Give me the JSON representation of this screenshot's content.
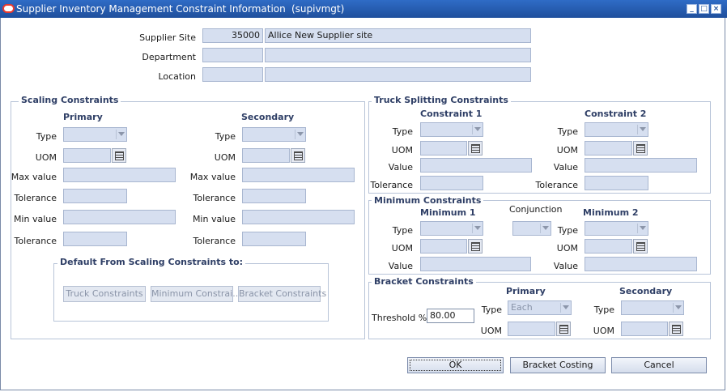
{
  "window": {
    "title": "Supplier Inventory Management Constraint Information",
    "form_code": "(supivmgt)"
  },
  "header": {
    "supplier_site_label": "Supplier Site",
    "supplier_site_id": "35000",
    "supplier_site_name": "Allice New Supplier site",
    "department_label": "Department",
    "location_label": "Location"
  },
  "scaling": {
    "title": "Scaling Constraints",
    "primary_header": "Primary",
    "secondary_header": "Secondary",
    "type_label": "Type",
    "uom_label": "UOM",
    "max_value_label": "Max value",
    "tolerance_label": "Tolerance",
    "min_value_label": "Min value",
    "default_title": "Default From Scaling Constraints to:",
    "truck_button": "Truck Constraints",
    "minimum_button": "Minimum Constrai...",
    "bracket_button": "Bracket Constraints"
  },
  "truck": {
    "title": "Truck Splitting Constraints",
    "c1_header": "Constraint 1",
    "c2_header": "Constraint 2",
    "type_label": "Type",
    "uom_label": "UOM",
    "value_label": "Value",
    "tolerance_label": "Tolerance"
  },
  "minimum": {
    "title": "Minimum Constraints",
    "m1_header": "Minimum 1",
    "conjunction_label": "Conjunction",
    "m2_header": "Minimum 2",
    "type_label": "Type",
    "uom_label": "UOM",
    "value_label": "Value"
  },
  "bracket": {
    "title": "Bracket Constraints",
    "primary_header": "Primary",
    "secondary_header": "Secondary",
    "threshold_label": "Threshold %",
    "threshold_value": "80.00",
    "type_label": "Type",
    "primary_type_value": "Each",
    "uom_label": "UOM"
  },
  "buttons": {
    "ok": "OK",
    "bracket_costing": "Bracket Costing",
    "cancel": "Cancel"
  },
  "colors": {
    "titlebar": "#2f6cc6",
    "field_bg": "#d6dff0",
    "section_title": "#2f3f66"
  }
}
